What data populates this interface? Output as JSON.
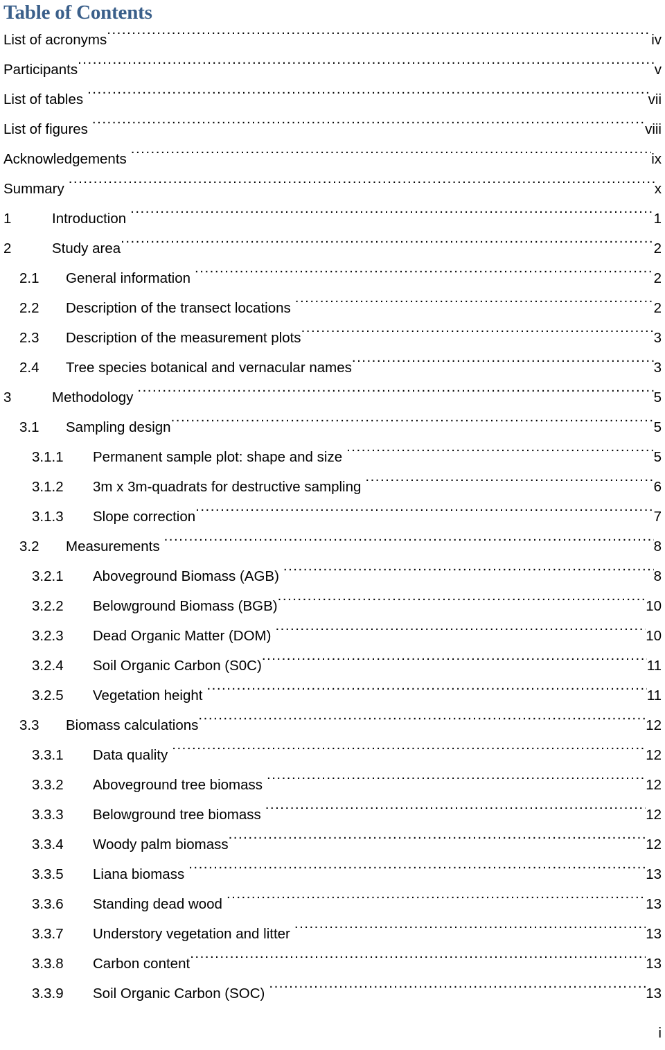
{
  "document": {
    "title": "Table of Contents",
    "folio": "i",
    "title_color": "#3a5f8a"
  },
  "entries": [
    {
      "level": 0,
      "number": "",
      "label": "List of acronyms",
      "page": "iv",
      "space_before_dots": false
    },
    {
      "level": 0,
      "number": "",
      "label": "Participants",
      "page": "v",
      "space_before_dots": false
    },
    {
      "level": 0,
      "number": "",
      "label": "List of tables",
      "page": "vii",
      "space_before_dots": true
    },
    {
      "level": 0,
      "number": "",
      "label": "List of figures",
      "page": "viii",
      "space_before_dots": true
    },
    {
      "level": 0,
      "number": "",
      "label": "Acknowledgements",
      "page": "ix",
      "space_before_dots": true
    },
    {
      "level": 0,
      "number": "",
      "label": "Summary",
      "page": "x",
      "space_before_dots": true
    },
    {
      "level": 1,
      "number": "1",
      "label": "Introduction",
      "page": "1",
      "space_before_dots": true
    },
    {
      "level": 1,
      "number": "2",
      "label": "Study area",
      "page": "2",
      "space_before_dots": false
    },
    {
      "level": 2,
      "number": "2.1",
      "label": "General information",
      "page": "2",
      "space_before_dots": true
    },
    {
      "level": 2,
      "number": "2.2",
      "label": "Description of the transect locations",
      "page": "2",
      "space_before_dots": true
    },
    {
      "level": 2,
      "number": "2.3",
      "label": "Description of the measurement plots",
      "page": "3",
      "space_before_dots": false
    },
    {
      "level": 2,
      "number": "2.4",
      "label": "Tree species botanical and vernacular names",
      "page": "3",
      "space_before_dots": false
    },
    {
      "level": 1,
      "number": "3",
      "label": "Methodology",
      "page": "5",
      "space_before_dots": true
    },
    {
      "level": 2,
      "number": "3.1",
      "label": "Sampling design",
      "page": "5",
      "space_before_dots": false
    },
    {
      "level": 3,
      "number": "3.1.1",
      "label": "Permanent sample plot: shape and size",
      "page": "5",
      "space_before_dots": true
    },
    {
      "level": 3,
      "number": "3.1.2",
      "label": "3m x 3m-quadrats for destructive sampling",
      "page": "6",
      "space_before_dots": true
    },
    {
      "level": 3,
      "number": "3.1.3",
      "label": "Slope correction",
      "page": "7",
      "space_before_dots": false
    },
    {
      "level": 2,
      "number": "3.2",
      "label": "Measurements",
      "page": "8",
      "space_before_dots": true
    },
    {
      "level": 3,
      "number": "3.2.1",
      "label": "Aboveground Biomass (AGB)",
      "page": "8",
      "space_before_dots": true
    },
    {
      "level": 3,
      "number": "3.2.2",
      "label": "Belowground Biomass (BGB)",
      "page": "10",
      "space_before_dots": false
    },
    {
      "level": 3,
      "number": "3.2.3",
      "label": "Dead Organic Matter (DOM)",
      "page": "10",
      "space_before_dots": true
    },
    {
      "level": 3,
      "number": "3.2.4",
      "label": "Soil Organic Carbon (S0C)",
      "page": "11",
      "space_before_dots": false
    },
    {
      "level": 3,
      "number": "3.2.5",
      "label": "Vegetation height",
      "page": "11",
      "space_before_dots": true
    },
    {
      "level": 2,
      "number": "3.3",
      "label": "Biomass calculations",
      "page": "12",
      "space_before_dots": false
    },
    {
      "level": 3,
      "number": "3.3.1",
      "label": "Data quality",
      "page": "12",
      "space_before_dots": true
    },
    {
      "level": 3,
      "number": "3.3.2",
      "label": "Aboveground tree biomass",
      "page": "12",
      "space_before_dots": true
    },
    {
      "level": 3,
      "number": "3.3.3",
      "label": "Belowground tree biomass",
      "page": "12",
      "space_before_dots": true
    },
    {
      "level": 3,
      "number": "3.3.4",
      "label": "Woody palm biomass",
      "page": "12",
      "space_before_dots": false
    },
    {
      "level": 3,
      "number": "3.3.5",
      "label": "Liana biomass",
      "page": "13",
      "space_before_dots": true
    },
    {
      "level": 3,
      "number": "3.3.6",
      "label": "Standing dead wood",
      "page": "13",
      "space_before_dots": true
    },
    {
      "level": 3,
      "number": "3.3.7",
      "label": "Understory vegetation and litter",
      "page": "13",
      "space_before_dots": true
    },
    {
      "level": 3,
      "number": "3.3.8",
      "label": "Carbon content",
      "page": "13",
      "space_before_dots": false
    },
    {
      "level": 3,
      "number": "3.3.9",
      "label": "Soil Organic Carbon (SOC)",
      "page": "13",
      "space_before_dots": true
    }
  ]
}
